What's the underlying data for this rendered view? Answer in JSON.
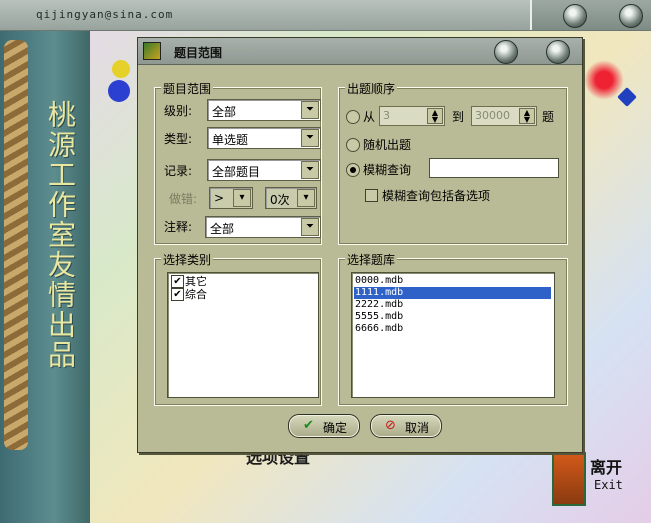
{
  "app": {
    "email": "qijingyan@sina.com",
    "vertical_text": "桃源工作室友情出品",
    "bottom_caption": "选项设置",
    "exit_label": "离开",
    "exit_sub": "Exit"
  },
  "dialog": {
    "title": "题目范围",
    "range_group": {
      "title": "题目范围",
      "level_label": "级别:",
      "level_value": "全部",
      "type_label": "类型:",
      "type_value": "单选题",
      "record_label": "记录:",
      "record_value": "全部题目",
      "wrong_label": "做错:",
      "wrong_op_value": ">",
      "wrong_count_value": "0次",
      "note_label": "注释:",
      "note_value": "全部"
    },
    "order_group": {
      "title": "出题顺序",
      "from_label": "从",
      "from_value": "3",
      "to_label": "到",
      "to_value": "30000",
      "unit_label": "题",
      "random_label": "随机出题",
      "fuzzy_label": "模糊查询",
      "fuzzy_value": "",
      "fuzzy_options_label": "模糊查询包括备选项"
    },
    "category_group": {
      "title": "选择类别",
      "items": [
        {
          "label": "其它",
          "checked": true
        },
        {
          "label": "综合",
          "checked": true
        }
      ]
    },
    "bank_group": {
      "title": "选择题库",
      "items": [
        "0000.mdb",
        "1111.mdb",
        "2222.mdb",
        "5555.mdb",
        "6666.mdb"
      ],
      "selected_index": 1
    },
    "ok_label": "确定",
    "cancel_label": "取消"
  },
  "colors": {
    "dialog_bg": "#b9bb96",
    "selection": "#2f62c8",
    "left_panel": "#3d6b72"
  },
  "icons": {
    "ok": "check-icon",
    "cancel": "no-entry-icon",
    "dialog": "app-icon",
    "combo": "dropdown-arrow-icon"
  }
}
